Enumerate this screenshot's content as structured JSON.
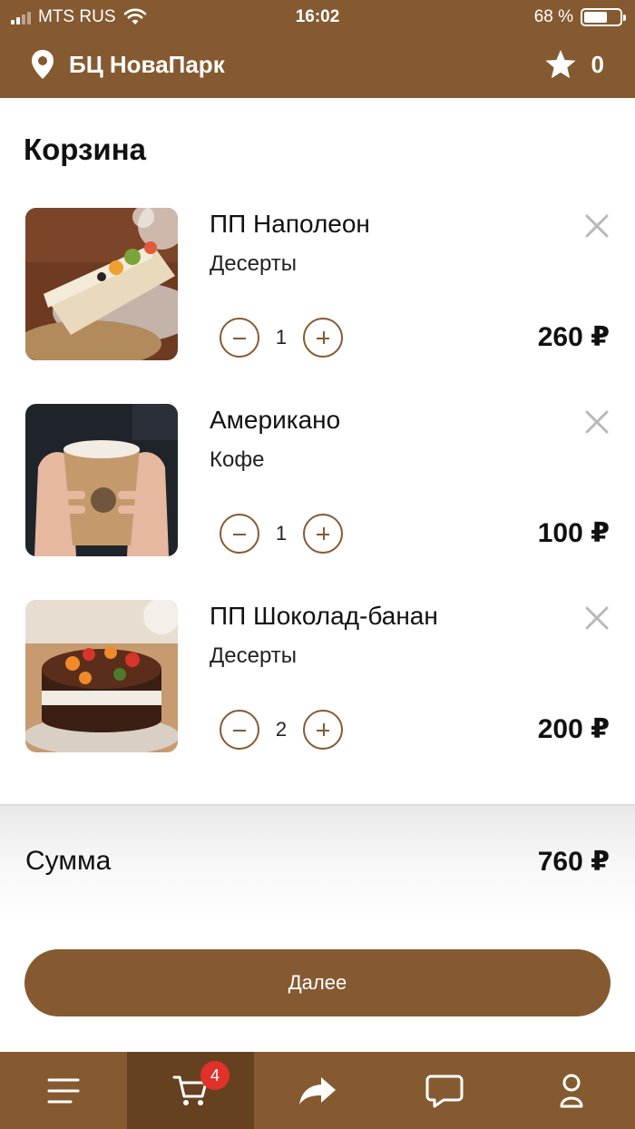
{
  "status_bar": {
    "carrier": "MTS RUS",
    "time": "16:02",
    "battery": "68 %",
    "battery_level": 0.68
  },
  "header": {
    "location_icon": "location-pin-icon",
    "location": "БЦ НоваПарк",
    "favorites_icon": "star-icon",
    "favorites_count": "0"
  },
  "page_title": "Корзина",
  "cart_items": [
    {
      "name": "ПП Наполеон",
      "category": "Десерты",
      "quantity": "1",
      "price": "260 ₽",
      "image": "napoleon-cake-photo"
    },
    {
      "name": "Американо",
      "category": "Кофе",
      "quantity": "1",
      "price": "100 ₽",
      "image": "americano-cup-photo"
    },
    {
      "name": "ПП Шоколад-банан",
      "category": "Десерты",
      "quantity": "2",
      "price": "200 ₽",
      "image": "chocolate-banana-cake-photo"
    }
  ],
  "summary": {
    "label": "Сумма",
    "total": "760 ₽"
  },
  "next_button": "Далее",
  "tabbar": {
    "items": [
      {
        "icon": "menu-icon"
      },
      {
        "icon": "cart-icon",
        "badge": "4",
        "active": true
      },
      {
        "icon": "share-icon"
      },
      {
        "icon": "chat-icon"
      },
      {
        "icon": "profile-icon"
      }
    ]
  },
  "colors": {
    "brand": "#855a31",
    "brand_dark": "#66411f",
    "badge": "#e0312a"
  }
}
